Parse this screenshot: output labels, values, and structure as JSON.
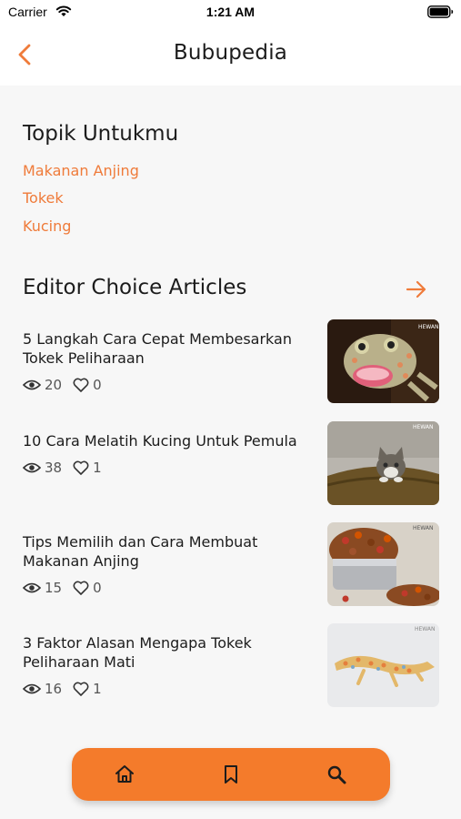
{
  "status": {
    "carrier": "Carrier",
    "time": "1:21 AM"
  },
  "nav": {
    "title": "Bubupedia"
  },
  "topics": {
    "heading": "Topik Untukmu",
    "items": [
      "Makanan Anjing",
      "Tokek",
      "Kucing"
    ]
  },
  "editor": {
    "heading": "Editor Choice Articles",
    "articles": [
      {
        "title": "5 Langkah Cara Cepat Membesarkan Tokek Peliharaan",
        "views": "20",
        "likes": "0",
        "image": "gecko-photo"
      },
      {
        "title": "10 Cara Melatih Kucing Untuk Pemula",
        "views": "38",
        "likes": "1",
        "image": "kitten-photo"
      },
      {
        "title": "Tips Memilih dan Cara Membuat Makanan Anjing",
        "views": "15",
        "likes": "0",
        "image": "dog-food-photo"
      },
      {
        "title": "3 Faktor Alasan Mengapa Tokek Peliharaan Mati",
        "views": "16",
        "likes": "1",
        "image": "gecko-white-photo"
      }
    ]
  },
  "colors": {
    "accent": "#f47b2b",
    "link": "#ef7b3a"
  },
  "tabs": [
    "home-icon",
    "bookmark-icon",
    "search-icon"
  ]
}
